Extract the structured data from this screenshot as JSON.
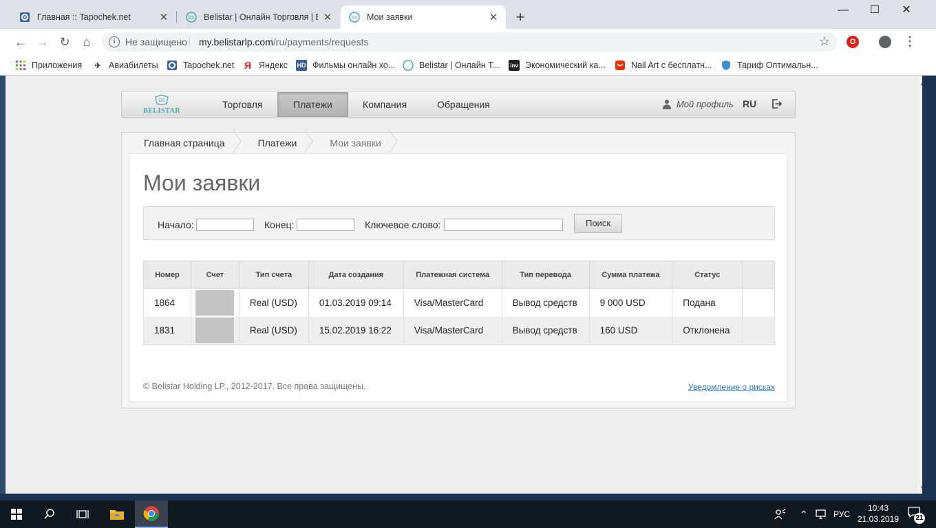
{
  "browser": {
    "tabs": [
      {
        "title": "Главная :: Tapochek.net",
        "icon": "gear-icon"
      },
      {
        "title": "Belistar | Онлайн Торговля | Бин",
        "icon": "belistar-icon"
      },
      {
        "title": "Мои заявки",
        "icon": "belistar-icon"
      }
    ],
    "new_tab": "+",
    "security_label": "Не защищено",
    "url_host": "my.belistarlp.com",
    "url_path": "/ru/payments/requests",
    "bookmarks": [
      {
        "label": "Приложения",
        "icon": "apps-grid-icon"
      },
      {
        "label": "Авиабилеты",
        "icon": "plane-icon"
      },
      {
        "label": "Tapochek.net",
        "icon": "gear-icon"
      },
      {
        "label": "Яндекс",
        "icon": "yandex-icon",
        "glyph": "Я"
      },
      {
        "label": "Фильмы онлайн хо...",
        "icon": "hd-icon",
        "glyph": "HD"
      },
      {
        "label": "Belistar | Онлайн Т...",
        "icon": "belistar-icon"
      },
      {
        "label": "Экономический ка...",
        "icon": "investing-icon",
        "glyph": "inv"
      },
      {
        "label": "Nail Art с бесплатн...",
        "icon": "aliexpress-icon"
      },
      {
        "label": "Тариф Оптимальн...",
        "icon": "shield-icon"
      }
    ]
  },
  "site": {
    "logo_text": "BELISTAR",
    "nav": [
      {
        "label": "Торговля"
      },
      {
        "label": "Платежи",
        "active": true
      },
      {
        "label": "Компания"
      },
      {
        "label": "Обращения"
      }
    ],
    "profile_label": "Мой профиль",
    "language": "RU"
  },
  "breadcrumb": [
    "Главная страница",
    "Платежи",
    "Мои заявки"
  ],
  "page_title": "Мои заявки",
  "filter": {
    "start_label": "Начало:",
    "end_label": "Конец:",
    "keyword_label": "Ключевое слово:",
    "start_value": "",
    "end_value": "",
    "keyword_value": "",
    "search_button": "Поиск"
  },
  "table": {
    "headers": [
      "Номер",
      "Счет",
      "Тип счета",
      "Дата создания",
      "Платежная система",
      "Тип перевода",
      "Сумма платежа",
      "Статус",
      ""
    ],
    "rows": [
      {
        "number": "1864",
        "account": "",
        "account_type": "Real (USD)",
        "created": "01.03.2019 09:14",
        "system": "Visa/MasterCard",
        "transfer": "Вывод средств",
        "amount": "9 000 USD",
        "status": "Подана"
      },
      {
        "number": "1831",
        "account": "",
        "account_type": "Real (USD)",
        "created": "15.02.2019 16:22",
        "system": "Visa/MasterCard",
        "transfer": "Вывод средств",
        "amount": "160 USD",
        "status": "Отклонена"
      }
    ]
  },
  "footer": {
    "copyright": "© Belistar Holding LP., 2012-2017. Все права защищены.",
    "risk_link": "Уведомление о рисках"
  },
  "taskbar": {
    "language": "РУС",
    "time": "10:43",
    "date": "21.03.2019",
    "notifications": "21"
  },
  "colors": {
    "accent_link": "#2a7bc4",
    "logo": "#4aa8b0",
    "opera_red": "#e0201a"
  }
}
